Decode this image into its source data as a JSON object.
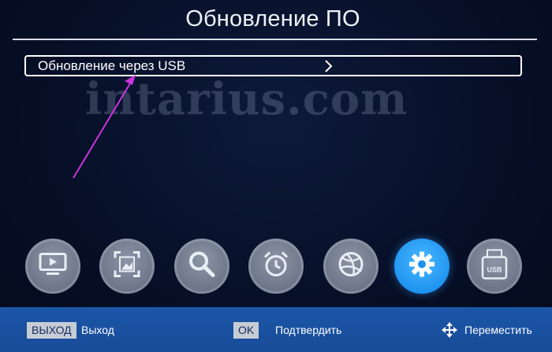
{
  "header": {
    "title": "Обновление ПО"
  },
  "menu": {
    "items": [
      {
        "label": "Обновление через USB",
        "icon": "chevron-right-icon"
      }
    ]
  },
  "watermark": {
    "text": "intarius.com"
  },
  "annotation": {
    "arrow_color": "#cc33dd"
  },
  "toolbar": {
    "icons": [
      {
        "name": "tv-icon",
        "active": false
      },
      {
        "name": "picture-icon",
        "active": false
      },
      {
        "name": "search-icon",
        "active": false
      },
      {
        "name": "alarm-clock-icon",
        "active": false
      },
      {
        "name": "globe-icon",
        "active": false
      },
      {
        "name": "gear-icon",
        "active": true
      },
      {
        "name": "usb-drive-icon",
        "active": false,
        "text": "USB"
      }
    ]
  },
  "footer": {
    "exit_key": "ВЫХОД",
    "exit_label": "Выход",
    "ok_key": "OK",
    "ok_label": "Подтвердить",
    "move_icon": "move-arrows-icon",
    "move_label": "Переместить"
  },
  "colors": {
    "background": "#071028",
    "accent": "#1d93f0",
    "footer": "#1c56a8"
  }
}
